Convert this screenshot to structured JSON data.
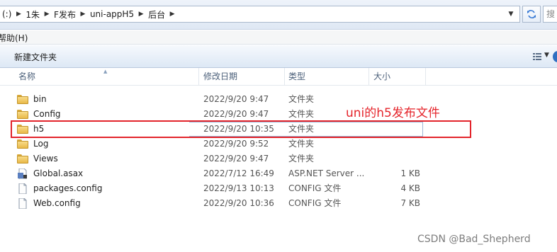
{
  "address_bar": {
    "crumbs": [
      "(:)",
      "1朱",
      "F发布",
      "uni-appH5",
      "后台"
    ],
    "search_placeholder": "搜"
  },
  "menu": {
    "visible_item": "帮助(H)"
  },
  "command_bar": {
    "new_folder_label": "新建文件夹"
  },
  "columns": {
    "name": "名称",
    "modified": "修改日期",
    "type": "类型",
    "size": "大小"
  },
  "files": [
    {
      "name": "bin",
      "modified": "2022/9/20 9:47",
      "type": "文件夹",
      "size": "",
      "icon": "folder-icon"
    },
    {
      "name": "Config",
      "modified": "2022/9/20 9:47",
      "type": "文件夹",
      "size": "",
      "icon": "folder-icon"
    },
    {
      "name": "h5",
      "modified": "2022/9/20 10:35",
      "type": "文件夹",
      "size": "",
      "icon": "folder-icon"
    },
    {
      "name": "Log",
      "modified": "2022/9/20 9:52",
      "type": "文件夹",
      "size": "",
      "icon": "folder-icon"
    },
    {
      "name": "Views",
      "modified": "2022/9/20 9:47",
      "type": "文件夹",
      "size": "",
      "icon": "folder-icon"
    },
    {
      "name": "Global.asax",
      "modified": "2022/7/12 16:49",
      "type": "ASP.NET Server ...",
      "size": "1 KB",
      "icon": "asax-file-icon"
    },
    {
      "name": "packages.config",
      "modified": "2022/9/13 10:13",
      "type": "CONFIG 文件",
      "size": "4 KB",
      "icon": "config-file-icon"
    },
    {
      "name": "Web.config",
      "modified": "2022/9/20 10:36",
      "type": "CONFIG 文件",
      "size": "7 KB",
      "icon": "config-file-icon"
    }
  ],
  "annotation": {
    "text": "uni的h5发布文件",
    "color": "#e5242b"
  },
  "watermark": "CSDN @Bad_Shepherd",
  "colors": {
    "highlight_border": "#e3242b",
    "header_text": "#4c607a"
  }
}
